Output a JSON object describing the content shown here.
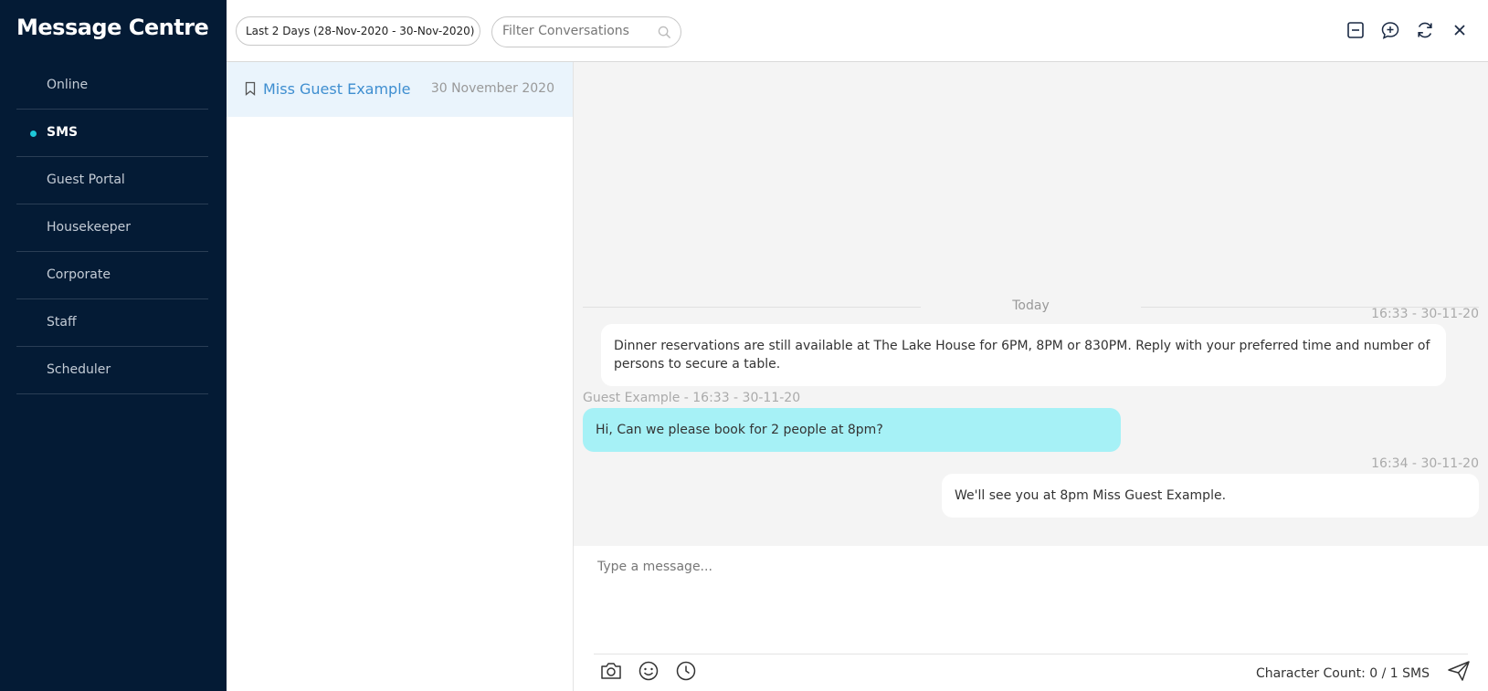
{
  "app_title": "Message Centre",
  "nav": {
    "items": [
      {
        "label": "Online",
        "active": false
      },
      {
        "label": "SMS",
        "active": true
      },
      {
        "label": "Guest Portal",
        "active": false
      },
      {
        "label": "Housekeeper",
        "active": false
      },
      {
        "label": "Corporate",
        "active": false
      },
      {
        "label": "Staff",
        "active": false
      },
      {
        "label": "Scheduler",
        "active": false
      }
    ]
  },
  "toolbar": {
    "date_range": "Last 2 Days (28-Nov-2020 - 30-Nov-2020)",
    "filter_placeholder": "Filter Conversations",
    "icons": [
      "minimize-icon",
      "new-message-icon",
      "refresh-icon",
      "close-icon"
    ]
  },
  "conversations": [
    {
      "name": "Miss Guest Example",
      "date": "30 November 2020"
    }
  ],
  "chat": {
    "day_label": "Today",
    "messages": [
      {
        "meta": "16:33 - 30-11-20",
        "text": "Dinner reservations are still available at The Lake House for 6PM, 8PM or 830PM. Reply with your preferred time and number of persons to secure a table.",
        "from": "hotel"
      },
      {
        "meta": "Guest Example - 16:33 - 30-11-20",
        "text": "Hi, Can we please book for 2 people at 8pm?",
        "from": "guest"
      },
      {
        "meta": "16:34 - 30-11-20",
        "text": "We'll see you at 8pm Miss Guest Example.",
        "from": "hotel"
      }
    ]
  },
  "composer": {
    "placeholder": "Type a message...",
    "character_count": "Character Count: 0 / 1 SMS"
  },
  "colors": {
    "sidebar_bg": "#041b35",
    "active_dot": "#1ec8d8",
    "guest_bubble": "#a6f1f6",
    "link_blue": "#3e8ed0"
  }
}
